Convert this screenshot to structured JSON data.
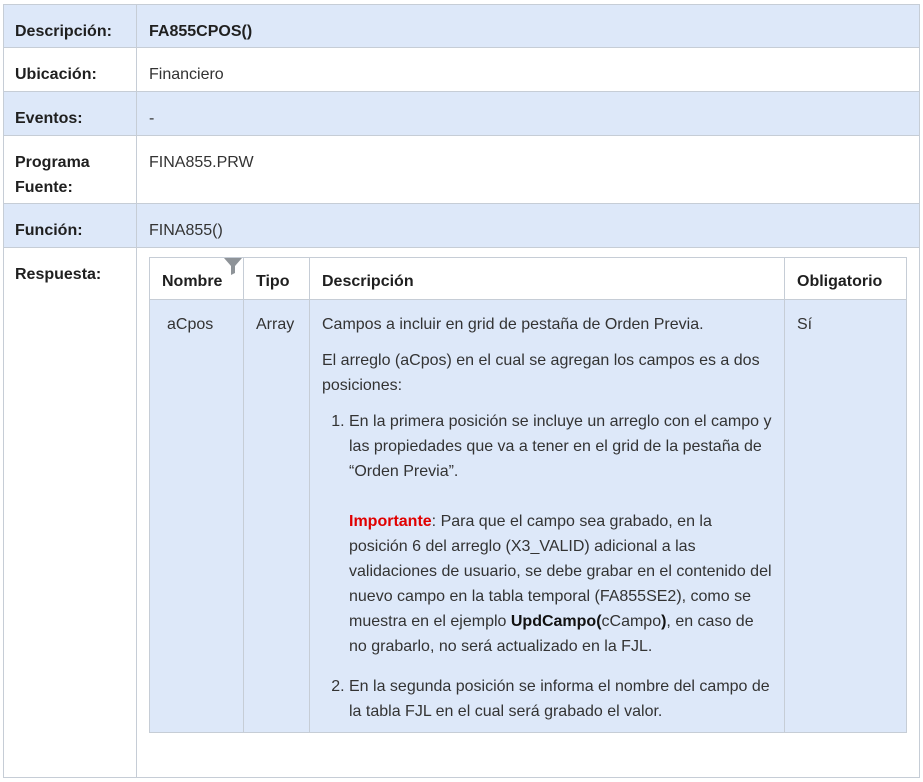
{
  "rows": {
    "descripcion": {
      "label": "Descripción:",
      "value": "FA855CPOS()"
    },
    "ubicacion": {
      "label": "Ubicación:",
      "value": "Financiero"
    },
    "eventos": {
      "label": "Eventos:",
      "value": "-"
    },
    "programa": {
      "label": "Programa Fuente:",
      "value": "FINA855.PRW"
    },
    "funcion": {
      "label": "Función:",
      "value": "FINA855()"
    },
    "respuesta": {
      "label": "Respuesta:"
    }
  },
  "inner": {
    "headers": [
      "Nombre",
      "Tipo",
      "Descripción",
      "Obligatorio"
    ],
    "row": {
      "nombre": "aCpos",
      "tipo": "Array",
      "desc1": "Campos a incluir en grid de pestaña de Orden Previa.",
      "desc2": "El arreglo (aCpos) en el cual se agregan los campos es a dos posiciones:",
      "item1": "En la primera posición se incluye un arreglo con el campo y las propiedades que va a tener en el grid de la pestaña de “Orden Previa”.",
      "imp_label": "Importante",
      "imp_text1": ": Para que el campo sea grabado, en la posición 6 del arreglo (X3_VALID) adicional a las validaciones de usuario, se debe grabar en el contenido del nuevo campo en la tabla temporal (FA855SE2), como se muestra en el ejemplo ",
      "imp_bold1": "UpdCampo(",
      "imp_mid": "cCampo",
      "imp_bold2": ")",
      "imp_text2": ", en caso de no grabarlo, no será actualizado en la FJL.",
      "item2": "En la segunda posición se informa el nombre del campo de la tabla FJL en el cual será grabado el valor.",
      "obligatorio": "Sí"
    }
  },
  "colors": {
    "header_bg": "#dde8f9",
    "border": "#c6cdd6",
    "important": "#e00000"
  },
  "icons": {
    "filter": "filter-icon"
  }
}
